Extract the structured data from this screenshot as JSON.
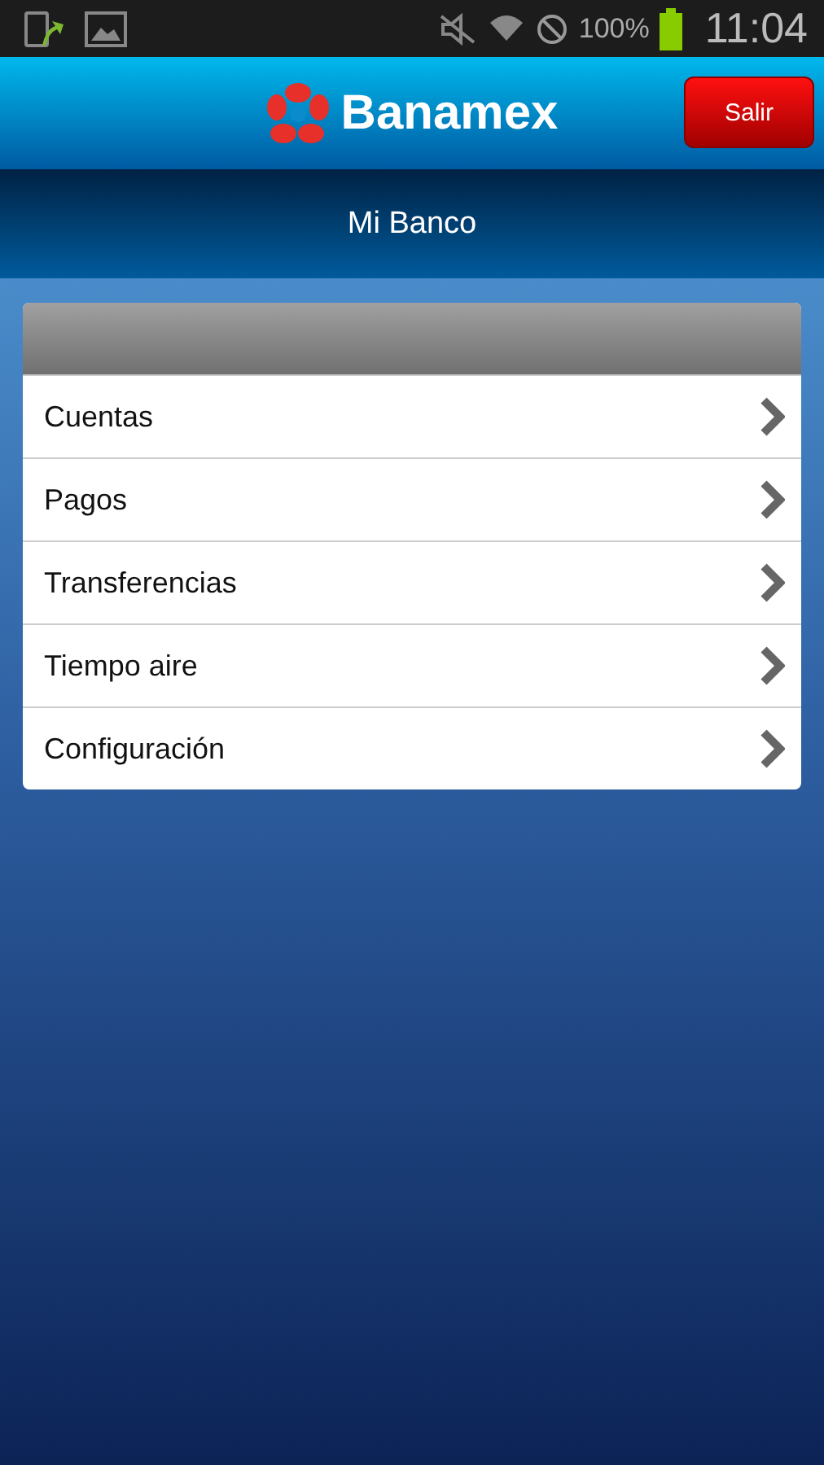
{
  "status_bar": {
    "battery": "100%",
    "time": "11:04"
  },
  "header": {
    "brand": "Banamex",
    "logout_button": "Salir"
  },
  "title": "Mi Banco",
  "menu": [
    {
      "label": "Cuentas"
    },
    {
      "label": "Pagos"
    },
    {
      "label": "Transferencias"
    },
    {
      "label": "Tiempo aire"
    },
    {
      "label": "Configuración"
    }
  ]
}
